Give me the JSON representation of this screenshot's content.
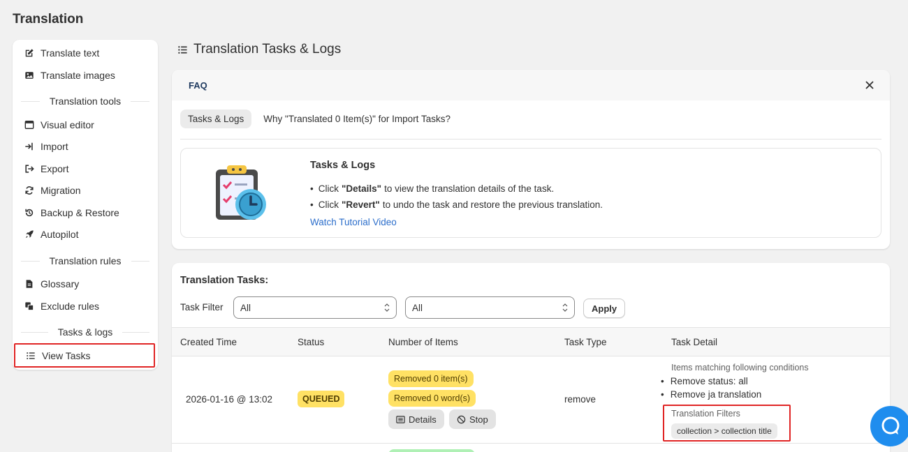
{
  "app": {
    "title": "Translation"
  },
  "sidebar": {
    "items": [
      {
        "label": "Translate text",
        "icon": "edit-icon"
      },
      {
        "label": "Translate images",
        "icon": "image-icon"
      },
      {
        "label": "Visual editor",
        "icon": "browser-icon"
      },
      {
        "label": "Import",
        "icon": "import-icon"
      },
      {
        "label": "Export",
        "icon": "export-icon"
      },
      {
        "label": "Migration",
        "icon": "refresh-icon"
      },
      {
        "label": "Backup & Restore",
        "icon": "history-icon"
      },
      {
        "label": "Autopilot",
        "icon": "rocket-icon"
      },
      {
        "label": "Glossary",
        "icon": "document-icon"
      },
      {
        "label": "Exclude rules",
        "icon": "layers-icon"
      },
      {
        "label": "View Tasks",
        "icon": "list-icon"
      }
    ],
    "sections": [
      "Translation tools",
      "Translation rules",
      "Tasks & logs"
    ],
    "active_item": "View Tasks"
  },
  "main": {
    "heading": "Translation Tasks & Logs",
    "faq": {
      "label": "FAQ",
      "tabs": [
        "Tasks & Logs",
        "Why \"Translated 0 Item(s)\" for Import Tasks?"
      ],
      "selected_tab": "Tasks & Logs",
      "body_title": "Tasks & Logs",
      "bullets": [
        {
          "pre": "Click",
          "bold": "\"Details\"",
          "post": "to view the translation details of the task."
        },
        {
          "pre": "Click",
          "bold": "\"Revert\"",
          "post": "to undo the task and restore the previous translation."
        }
      ],
      "link": "Watch Tutorial Video"
    },
    "tasks": {
      "title": "Translation Tasks:",
      "filter_label": "Task Filter",
      "filter_1": "All",
      "filter_2": "All",
      "apply_label": "Apply",
      "columns": [
        "Created Time",
        "Status",
        "Number of Items",
        "Task Type",
        "Task Detail"
      ],
      "rows": [
        {
          "created": "2026-01-16 @ 13:02",
          "status": "QUEUED",
          "items_badge": "Removed 0 item(s)",
          "words_badge": "Removed 0 word(s)",
          "details_label": "Details",
          "stop_label": "Stop",
          "type": "remove",
          "detail_caption": "Items matching following conditions",
          "detail_items": [
            "Remove status: all",
            "Remove ja translation"
          ],
          "filters_caption": "Translation Filters",
          "filter_tag": "collection > collection title"
        }
      ]
    }
  },
  "colors": {
    "accent": "#1f8dee",
    "highlight": "#e02424",
    "status_queued": "#ffe164"
  }
}
